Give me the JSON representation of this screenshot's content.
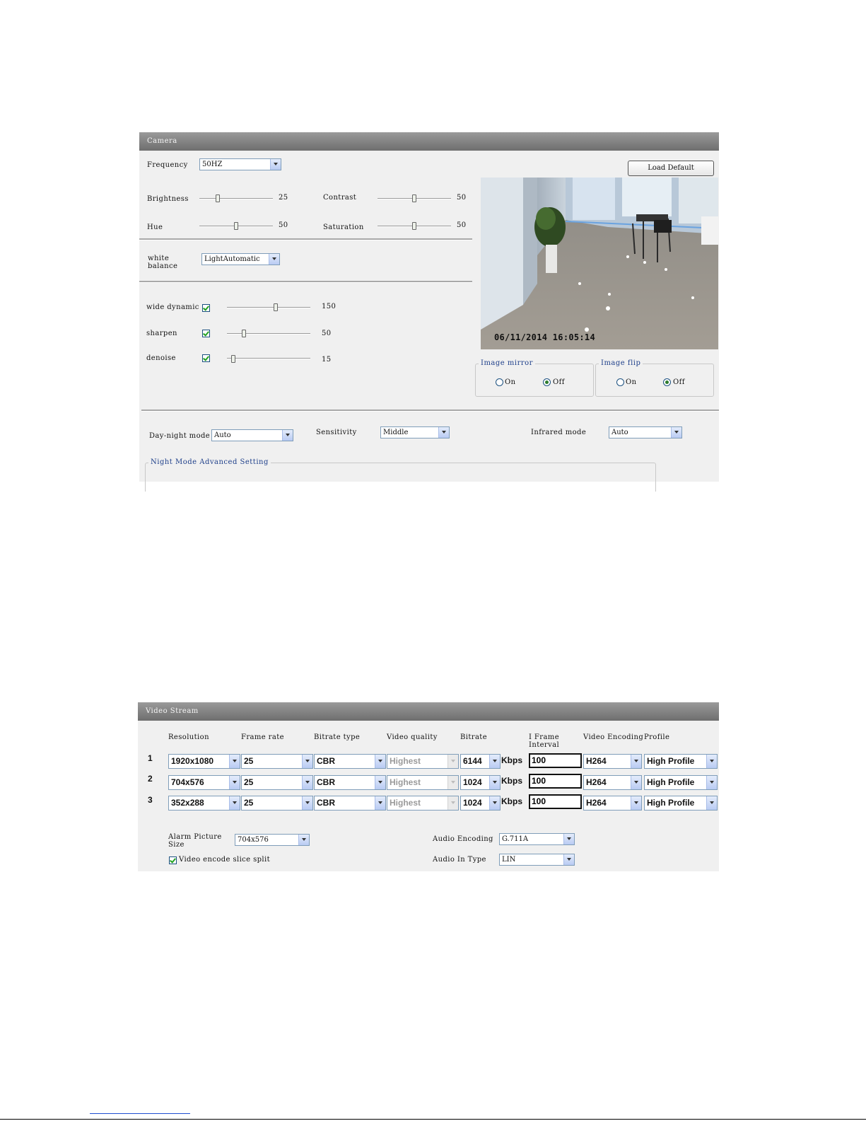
{
  "camera": {
    "title": "Camera",
    "frequency": {
      "label": "Frequency",
      "value": "50HZ"
    },
    "load_default": "Load Default",
    "brightness": {
      "label": "Brightness",
      "value": "25"
    },
    "contrast": {
      "label": "Contrast",
      "value": "50"
    },
    "hue": {
      "label": "Hue",
      "value": "50"
    },
    "saturation": {
      "label": "Saturation",
      "value": "50"
    },
    "white_balance": {
      "label_line1": "white",
      "label_line2": "balance",
      "value": "LightAutomatic"
    },
    "wide_dynamic": {
      "label": "wide dynamic",
      "value": "150",
      "enabled": true
    },
    "sharpen": {
      "label": "sharpen",
      "value": "50",
      "enabled": true
    },
    "denoise": {
      "label": "denoise",
      "value": "15",
      "enabled": true
    },
    "preview": {
      "timestamp": "06/11/2014 16:05:14"
    },
    "image_mirror": {
      "legend": "Image mirror",
      "on": "On",
      "off": "Off",
      "selected": "Off"
    },
    "image_flip": {
      "legend": "Image flip",
      "on": "On",
      "off": "Off",
      "selected": "Off"
    },
    "day_night_mode": {
      "label": "Day-night mode",
      "value": "Auto"
    },
    "sensitivity": {
      "label": "Sensitivity",
      "value": "Middle"
    },
    "infrared_mode": {
      "label": "Infrared mode",
      "value": "Auto"
    },
    "night_mode_advanced": "Night Mode Advanced Setting"
  },
  "video_stream": {
    "title": "Video Stream",
    "headers": {
      "resolution": "Resolution",
      "frame_rate": "Frame rate",
      "bitrate_type": "Bitrate type",
      "video_quality": "Video quality",
      "bitrate": "Bitrate",
      "i_frame_line1": "I Frame",
      "i_frame_line2": "Interval",
      "video_encoding": "Video Encoding",
      "profile": "Profile"
    },
    "unit": "Kbps",
    "rows": [
      {
        "num": "1",
        "resolution": "1920x1080",
        "frame_rate": "25",
        "bitrate_type": "CBR",
        "quality": "Highest",
        "bitrate": "6144",
        "i_frame": "100",
        "encoding": "H264",
        "profile": "High Profile"
      },
      {
        "num": "2",
        "resolution": "704x576",
        "frame_rate": "25",
        "bitrate_type": "CBR",
        "quality": "Highest",
        "bitrate": "1024",
        "i_frame": "100",
        "encoding": "H264",
        "profile": "High Profile"
      },
      {
        "num": "3",
        "resolution": "352x288",
        "frame_rate": "25",
        "bitrate_type": "CBR",
        "quality": "Highest",
        "bitrate": "1024",
        "i_frame": "100",
        "encoding": "H264",
        "profile": "High Profile"
      }
    ],
    "alarm_picture": {
      "label_line1": "Alarm Picture",
      "label_line2": "Size",
      "value": "704x576"
    },
    "audio_encoding": {
      "label": "Audio Encoding",
      "value": "G.711A"
    },
    "slice_split": {
      "label": "Video encode slice split",
      "enabled": true
    },
    "audio_in_type": {
      "label": "Audio In Type",
      "value": "LIN"
    }
  },
  "slider_levels": {
    "brightness": 0.25,
    "contrast": 0.5,
    "hue": 0.5,
    "saturation": 0.5,
    "wide_dynamic": 0.59,
    "sharpen": 0.2,
    "denoise": 0.06
  }
}
